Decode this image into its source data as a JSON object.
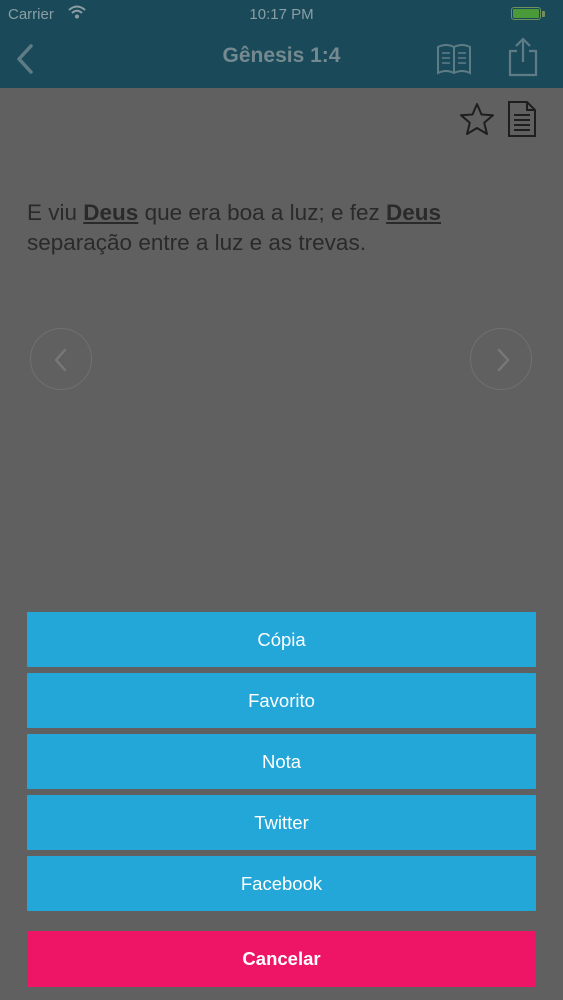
{
  "status_bar": {
    "carrier": "Carrier",
    "time": "10:17 PM",
    "battery_level": 1.0
  },
  "nav": {
    "title": "Gênesis 1:4",
    "icons": [
      "chevron-left-icon",
      "book-icon",
      "share-icon"
    ]
  },
  "verse": {
    "parts": [
      "E viu ",
      "Deus",
      " que era boa a luz; e fez ",
      "Deus",
      " separação entre a luz e as trevas."
    ]
  },
  "toolbar_icons": [
    "star-icon",
    "note-icon"
  ],
  "actions": {
    "items": [
      "Cópia",
      "Favorito",
      "Nota",
      "Twitter",
      "Facebook"
    ],
    "cancel": "Cancelar"
  },
  "colors": {
    "nav_background": "#1a4a59",
    "overlay": "#606060",
    "action_button": "#23a6d8",
    "cancel_button": "#ee1566"
  }
}
